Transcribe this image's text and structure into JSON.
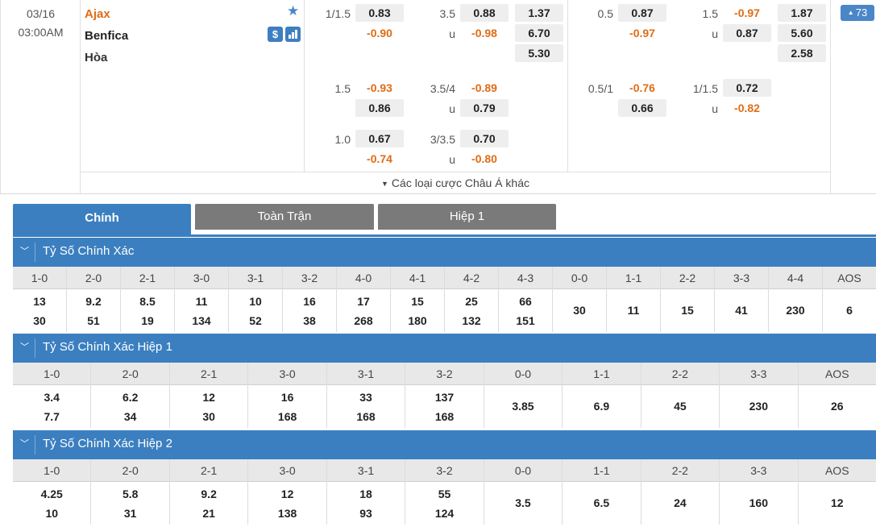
{
  "match": {
    "date": "03/16",
    "time": "03:00AM",
    "home": "Ajax",
    "away": "Benfica",
    "draw": "Hòa",
    "dollar_icon_label": "$"
  },
  "odds_block_1": {
    "rows": [
      {
        "hdp_line": "1/1.5",
        "hdp_home": "0.83",
        "hdp_away": "-0.90",
        "ou_line": "3.5",
        "ou_over": "0.88",
        "ou_under_label": "u",
        "ou_under": "-0.98",
        "x_home": "1.37",
        "x_away": "6.70",
        "x_draw": "5.30"
      },
      {
        "hdp_line": "1.5",
        "hdp_home": "-0.93",
        "hdp_away": "0.86",
        "ou_line": "3.5/4",
        "ou_over": "-0.89",
        "ou_under_label": "u",
        "ou_under": "0.79"
      },
      {
        "hdp_line": "1.0",
        "hdp_home": "0.67",
        "hdp_away": "-0.74",
        "ou_line": "3/3.5",
        "ou_over": "0.70",
        "ou_under_label": "u",
        "ou_under": "-0.80"
      }
    ]
  },
  "odds_block_2": {
    "rows": [
      {
        "hdp_line": "0.5",
        "hdp_home": "0.87",
        "hdp_away": "-0.97",
        "ou_line": "1.5",
        "ou_over": "-0.97",
        "ou_under_label": "u",
        "ou_under": "0.87",
        "x_home": "1.87",
        "x_away": "5.60",
        "x_draw": "2.58"
      },
      {
        "hdp_line": "0.5/1",
        "hdp_home": "-0.76",
        "hdp_away": "0.66",
        "ou_line": "1/1.5",
        "ou_over": "0.72",
        "ou_under_label": "u",
        "ou_under": "-0.82"
      }
    ]
  },
  "more_bets_label": "Các loại cược Châu Á khác",
  "more_count": "73",
  "tabs": [
    "Chính",
    "Toàn Trận",
    "Hiệp 1"
  ],
  "sections": [
    {
      "title": "Tỷ Số Chính Xác",
      "cols": [
        {
          "score": "1-0",
          "home": "13",
          "away": "30"
        },
        {
          "score": "2-0",
          "home": "9.2",
          "away": "51"
        },
        {
          "score": "2-1",
          "home": "8.5",
          "away": "19"
        },
        {
          "score": "3-0",
          "home": "11",
          "away": "134"
        },
        {
          "score": "3-1",
          "home": "10",
          "away": "52"
        },
        {
          "score": "3-2",
          "home": "16",
          "away": "38"
        },
        {
          "score": "4-0",
          "home": "17",
          "away": "268"
        },
        {
          "score": "4-1",
          "home": "15",
          "away": "180"
        },
        {
          "score": "4-2",
          "home": "25",
          "away": "132"
        },
        {
          "score": "4-3",
          "home": "66",
          "away": "151"
        },
        {
          "score": "0-0",
          "single": "30"
        },
        {
          "score": "1-1",
          "single": "11"
        },
        {
          "score": "2-2",
          "single": "15"
        },
        {
          "score": "3-3",
          "single": "41"
        },
        {
          "score": "4-4",
          "single": "230"
        },
        {
          "score": "AOS",
          "single": "6"
        }
      ]
    },
    {
      "title": "Tỷ Số Chính Xác Hiệp 1",
      "cols": [
        {
          "score": "1-0",
          "home": "3.4",
          "away": "7.7"
        },
        {
          "score": "2-0",
          "home": "6.2",
          "away": "34"
        },
        {
          "score": "2-1",
          "home": "12",
          "away": "30"
        },
        {
          "score": "3-0",
          "home": "16",
          "away": "168"
        },
        {
          "score": "3-1",
          "home": "33",
          "away": "168"
        },
        {
          "score": "3-2",
          "home": "137",
          "away": "168"
        },
        {
          "score": "0-0",
          "single": "3.85"
        },
        {
          "score": "1-1",
          "single": "6.9"
        },
        {
          "score": "2-2",
          "single": "45"
        },
        {
          "score": "3-3",
          "single": "230"
        },
        {
          "score": "AOS",
          "single": "26"
        }
      ]
    },
    {
      "title": "Tỷ Số Chính Xác Hiệp 2",
      "cols": [
        {
          "score": "1-0",
          "home": "4.25",
          "away": "10"
        },
        {
          "score": "2-0",
          "home": "5.8",
          "away": "31"
        },
        {
          "score": "2-1",
          "home": "9.2",
          "away": "21"
        },
        {
          "score": "3-0",
          "home": "12",
          "away": "138"
        },
        {
          "score": "3-1",
          "home": "18",
          "away": "93"
        },
        {
          "score": "3-2",
          "home": "55",
          "away": "124"
        },
        {
          "score": "0-0",
          "single": "3.5"
        },
        {
          "score": "1-1",
          "single": "6.5"
        },
        {
          "score": "2-2",
          "single": "24"
        },
        {
          "score": "3-3",
          "single": "160"
        },
        {
          "score": "AOS",
          "single": "12"
        }
      ]
    }
  ],
  "colors": {
    "accent": "#3b7fc0",
    "negative": "#e06c15",
    "home_team": "#e06c15",
    "inactive_tab": "#7a7a7a"
  }
}
